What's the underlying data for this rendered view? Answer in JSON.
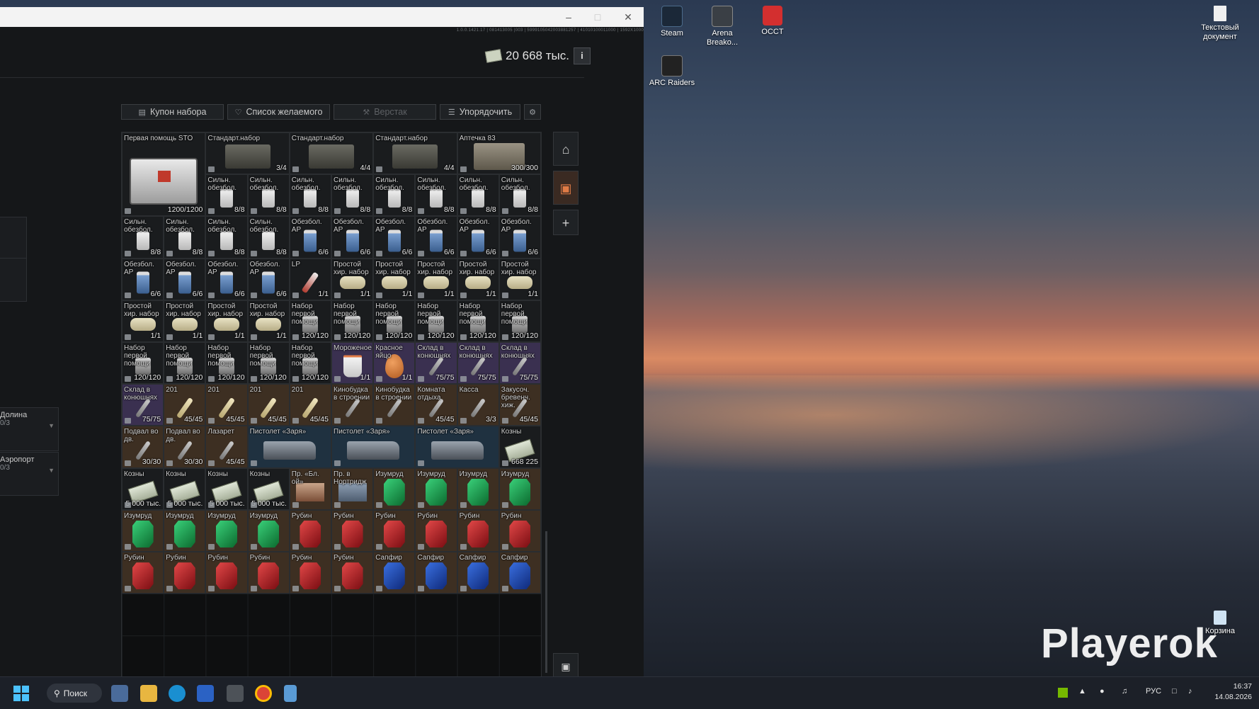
{
  "desktop": {
    "icons": [
      {
        "label": "Steam",
        "color": "#1b2838"
      },
      {
        "label": "Arena Breako...",
        "color": "#3a3f45"
      },
      {
        "label": "OCCT",
        "color": "#d32f2f"
      },
      {
        "label": "ARC Raiders",
        "color": "#222"
      },
      {
        "label": "Текстовый документ",
        "color": "#f0f0f0"
      },
      {
        "label": "Корзина",
        "color": "#cfe3f3"
      }
    ],
    "watermark": "Playerok"
  },
  "window": {
    "version": "1.0.0.1421.17 | 081413005 |003 | 5999105042003881257 | 41010100011000 | 1592X1000",
    "money": "20 668 тыс.",
    "info_label": "i",
    "toolbar": [
      {
        "label": "Купон набора",
        "icon": "gift-icon",
        "disabled": false
      },
      {
        "label": "Список желаемого",
        "icon": "heart-icon",
        "disabled": false
      },
      {
        "label": "Верстак",
        "icon": "wrench-icon",
        "disabled": true
      },
      {
        "label": "Упорядочить",
        "icon": "sort-icon",
        "disabled": false
      }
    ],
    "left_panels": [
      {
        "title": "Долина",
        "sub": "0/3"
      },
      {
        "title": "Аэропорт",
        "sub": "0/3"
      }
    ],
    "items": [
      {
        "name": "Первая помощь STO",
        "count": "1200/1200",
        "kind": "firstaid",
        "c": 0,
        "r": 0,
        "w": 2,
        "h": 2
      },
      {
        "name": "Стандарт.набор",
        "count": "3/4",
        "kind": "case",
        "c": 2,
        "r": 0,
        "w": 2,
        "h": 1
      },
      {
        "name": "Стандарт.набор",
        "count": "4/4",
        "kind": "case",
        "c": 4,
        "r": 0,
        "w": 2,
        "h": 1
      },
      {
        "name": "Стандарт.набор",
        "count": "4/4",
        "kind": "case",
        "c": 6,
        "r": 0,
        "w": 2,
        "h": 1
      },
      {
        "name": "Аптечка 83",
        "count": "300/300",
        "kind": "case2",
        "c": 8,
        "r": 0,
        "w": 2,
        "h": 1
      },
      {
        "name": "Сильн. обезбол.",
        "count": "8/8",
        "kind": "jar",
        "c": 2,
        "r": 1
      },
      {
        "name": "Сильн. обезбол.",
        "count": "8/8",
        "kind": "jar",
        "c": 3,
        "r": 1
      },
      {
        "name": "Сильн. обезбол.",
        "count": "8/8",
        "kind": "jar",
        "c": 4,
        "r": 1
      },
      {
        "name": "Сильн. обезбол.",
        "count": "8/8",
        "kind": "jar",
        "c": 5,
        "r": 1
      },
      {
        "name": "Сильн. обезбол.",
        "count": "8/8",
        "kind": "jar",
        "c": 6,
        "r": 1
      },
      {
        "name": "Сильн. обезбол.",
        "count": "8/8",
        "kind": "jar",
        "c": 7,
        "r": 1
      },
      {
        "name": "Сильн. обезбол.",
        "count": "8/8",
        "kind": "jar",
        "c": 8,
        "r": 1
      },
      {
        "name": "Сильн. обезбол.",
        "count": "8/8",
        "kind": "jar",
        "c": 9,
        "r": 1
      },
      {
        "name": "Сильн. обезбол.",
        "count": "8/8",
        "kind": "jar",
        "c": 0,
        "r": 2
      },
      {
        "name": "Сильн. обезбол.",
        "count": "8/8",
        "kind": "jar",
        "c": 1,
        "r": 2
      },
      {
        "name": "Сильн. обезбол.",
        "count": "8/8",
        "kind": "jar",
        "c": 2,
        "r": 2
      },
      {
        "name": "Сильн. обезбол.",
        "count": "8/8",
        "kind": "jar",
        "c": 3,
        "r": 2
      },
      {
        "name": "Обезбол. АР",
        "count": "6/6",
        "kind": "jarb",
        "c": 4,
        "r": 2
      },
      {
        "name": "Обезбол. АР",
        "count": "6/6",
        "kind": "jarb",
        "c": 5,
        "r": 2
      },
      {
        "name": "Обезбол. АР",
        "count": "6/6",
        "kind": "jarb",
        "c": 6,
        "r": 2
      },
      {
        "name": "Обезбол. АР",
        "count": "6/6",
        "kind": "jarb",
        "c": 7,
        "r": 2
      },
      {
        "name": "Обезбол. АР",
        "count": "6/6",
        "kind": "jarb",
        "c": 8,
        "r": 2
      },
      {
        "name": "Обезбол. АР",
        "count": "6/6",
        "kind": "jarb",
        "c": 9,
        "r": 2
      },
      {
        "name": "Обезбол. АР",
        "count": "6/6",
        "kind": "jarb",
        "c": 0,
        "r": 3
      },
      {
        "name": "Обезбол. АР",
        "count": "6/6",
        "kind": "jarb",
        "c": 1,
        "r": 3
      },
      {
        "name": "Обезбол. АР",
        "count": "6/6",
        "kind": "jarb",
        "c": 2,
        "r": 3
      },
      {
        "name": "Обезбол. АР",
        "count": "6/6",
        "kind": "jarb",
        "c": 3,
        "r": 3
      },
      {
        "name": "LP",
        "count": "1/1",
        "kind": "tube",
        "c": 4,
        "r": 3
      },
      {
        "name": "Простой хир. набор",
        "count": "1/1",
        "kind": "pouch",
        "c": 5,
        "r": 3
      },
      {
        "name": "Простой хир. набор",
        "count": "1/1",
        "kind": "pouch",
        "c": 6,
        "r": 3
      },
      {
        "name": "Простой хир. набор",
        "count": "1/1",
        "kind": "pouch",
        "c": 7,
        "r": 3
      },
      {
        "name": "Простой хир. набор",
        "count": "1/1",
        "kind": "pouch",
        "c": 8,
        "r": 3
      },
      {
        "name": "Простой хир. набор",
        "count": "1/1",
        "kind": "pouch",
        "c": 9,
        "r": 3
      },
      {
        "name": "Простой хир. набор",
        "count": "1/1",
        "kind": "pouch",
        "c": 0,
        "r": 4
      },
      {
        "name": "Простой хир. набор",
        "count": "1/1",
        "kind": "pouch",
        "c": 1,
        "r": 4
      },
      {
        "name": "Простой хир. набор",
        "count": "1/1",
        "kind": "pouch",
        "c": 2,
        "r": 4
      },
      {
        "name": "Простой хир. набор",
        "count": "1/1",
        "kind": "pouch",
        "c": 3,
        "r": 4
      },
      {
        "name": "Набор первой помощи",
        "count": "120/120",
        "kind": "kit",
        "c": 4,
        "r": 4
      },
      {
        "name": "Набор первой помощи",
        "count": "120/120",
        "kind": "kit",
        "c": 5,
        "r": 4
      },
      {
        "name": "Набор первой помощи",
        "count": "120/120",
        "kind": "kit",
        "c": 6,
        "r": 4
      },
      {
        "name": "Набор первой помощи",
        "count": "120/120",
        "kind": "kit",
        "c": 7,
        "r": 4
      },
      {
        "name": "Набор первой помощи",
        "count": "120/120",
        "kind": "kit",
        "c": 8,
        "r": 4
      },
      {
        "name": "Набор первой помощи",
        "count": "120/120",
        "kind": "kit",
        "c": 9,
        "r": 4
      },
      {
        "name": "Набор первой помощи",
        "count": "120/120",
        "kind": "kit",
        "c": 0,
        "r": 5
      },
      {
        "name": "Набор первой помощи",
        "count": "120/120",
        "kind": "kit",
        "c": 1,
        "r": 5
      },
      {
        "name": "Набор первой помощи",
        "count": "120/120",
        "kind": "kit",
        "c": 2,
        "r": 5
      },
      {
        "name": "Набор первой помощи",
        "count": "120/120",
        "kind": "kit",
        "c": 3,
        "r": 5
      },
      {
        "name": "Набор первой помощи",
        "count": "120/120",
        "kind": "kit",
        "c": 4,
        "r": 5
      },
      {
        "name": "Мороженое",
        "count": "1/1",
        "kind": "cup",
        "c": 5,
        "r": 5,
        "bg": "purple"
      },
      {
        "name": "Красное яйцо",
        "count": "1/1",
        "kind": "egg",
        "c": 6,
        "r": 5,
        "bg": "purple"
      },
      {
        "name": "Склад в конюшнях",
        "count": "75/75",
        "kind": "key",
        "c": 7,
        "r": 5,
        "bg": "purple"
      },
      {
        "name": "Склад в конюшнях",
        "count": "75/75",
        "kind": "key",
        "c": 8,
        "r": 5,
        "bg": "purple"
      },
      {
        "name": "Склад в конюшнях",
        "count": "75/75",
        "kind": "key",
        "c": 9,
        "r": 5,
        "bg": "purple"
      },
      {
        "name": "Склад в конюшнях",
        "count": "75/75",
        "kind": "key",
        "c": 0,
        "r": 6,
        "bg": "purple"
      },
      {
        "name": "201",
        "count": "45/45",
        "kind": "keyg",
        "c": 1,
        "r": 6,
        "bg": "brown"
      },
      {
        "name": "201",
        "count": "45/45",
        "kind": "keyg",
        "c": 2,
        "r": 6,
        "bg": "brown"
      },
      {
        "name": "201",
        "count": "45/45",
        "kind": "keyg",
        "c": 3,
        "r": 6,
        "bg": "brown"
      },
      {
        "name": "201",
        "count": "45/45",
        "kind": "keyg",
        "c": 4,
        "r": 6,
        "bg": "brown"
      },
      {
        "name": "Кинобудка в строении",
        "count": "",
        "kind": "key",
        "c": 5,
        "r": 6,
        "bg": "brown"
      },
      {
        "name": "Кинобудка в строении",
        "count": "",
        "kind": "key",
        "c": 6,
        "r": 6,
        "bg": "brown"
      },
      {
        "name": "Комната отдыха",
        "count": "45/45",
        "kind": "key",
        "c": 7,
        "r": 6,
        "bg": "brown"
      },
      {
        "name": "Касса",
        "count": "3/3",
        "kind": "key",
        "c": 8,
        "r": 6,
        "bg": "brown"
      },
      {
        "name": "Закусоч. бревенч. хиж.",
        "count": "45/45",
        "kind": "key",
        "c": 9,
        "r": 6,
        "bg": "brown"
      },
      {
        "name": "Подвал во дв.",
        "count": "30/30",
        "kind": "key",
        "c": 0,
        "r": 7,
        "bg": "brown"
      },
      {
        "name": "Подвал во дв.",
        "count": "30/30",
        "kind": "key",
        "c": 1,
        "r": 7,
        "bg": "brown"
      },
      {
        "name": "Лазарет",
        "count": "45/45",
        "kind": "key",
        "c": 2,
        "r": 7,
        "bg": "brown"
      },
      {
        "name": "Пистолет «Заря»",
        "count": "",
        "kind": "gun",
        "c": 3,
        "r": 7,
        "w": 2,
        "h": 1,
        "bg": "blue"
      },
      {
        "name": "Пистолет «Заря»",
        "count": "",
        "kind": "gun",
        "c": 5,
        "r": 7,
        "w": 2,
        "h": 1,
        "bg": "blue"
      },
      {
        "name": "Пистолет «Заря»",
        "count": "",
        "kind": "gun",
        "c": 7,
        "r": 7,
        "w": 2,
        "h": 1,
        "bg": "blue"
      },
      {
        "name": "Козны",
        "count": "668 225",
        "kind": "cash",
        "c": 9,
        "r": 7
      },
      {
        "name": "Козны",
        "count": "5 000 тыс.",
        "kind": "cash",
        "c": 0,
        "r": 8
      },
      {
        "name": "Козны",
        "count": "5 000 тыс.",
        "kind": "cash",
        "c": 1,
        "r": 8
      },
      {
        "name": "Козны",
        "count": "5 000 тыс.",
        "kind": "cash",
        "c": 2,
        "r": 8
      },
      {
        "name": "Козны",
        "count": "5 000 тыс.",
        "kind": "cash",
        "c": 3,
        "r": 8
      },
      {
        "name": "Пр. «Бл. ой»",
        "count": "",
        "kind": "doc",
        "c": 4,
        "r": 8,
        "bg": "brown"
      },
      {
        "name": "Пр. в Нортридж",
        "count": "",
        "kind": "doc2",
        "c": 5,
        "r": 8,
        "bg": "brown"
      },
      {
        "name": "Изумруд",
        "count": "",
        "kind": "emerald",
        "c": 6,
        "r": 8,
        "bg": "brown"
      },
      {
        "name": "Изумруд",
        "count": "",
        "kind": "emerald",
        "c": 7,
        "r": 8,
        "bg": "brown"
      },
      {
        "name": "Изумруд",
        "count": "",
        "kind": "emerald",
        "c": 8,
        "r": 8,
        "bg": "brown"
      },
      {
        "name": "Изумруд",
        "count": "",
        "kind": "emerald",
        "c": 9,
        "r": 8,
        "bg": "brown"
      },
      {
        "name": "Изумруд",
        "count": "",
        "kind": "emerald",
        "c": 0,
        "r": 9,
        "bg": "brown"
      },
      {
        "name": "Изумруд",
        "count": "",
        "kind": "emerald",
        "c": 1,
        "r": 9,
        "bg": "brown"
      },
      {
        "name": "Изумруд",
        "count": "",
        "kind": "emerald",
        "c": 2,
        "r": 9,
        "bg": "brown"
      },
      {
        "name": "Изумруд",
        "count": "",
        "kind": "emerald",
        "c": 3,
        "r": 9,
        "bg": "brown"
      },
      {
        "name": "Рубин",
        "count": "",
        "kind": "ruby",
        "c": 4,
        "r": 9,
        "bg": "brown"
      },
      {
        "name": "Рубин",
        "count": "",
        "kind": "ruby",
        "c": 5,
        "r": 9,
        "bg": "brown"
      },
      {
        "name": "Рубин",
        "count": "",
        "kind": "ruby",
        "c": 6,
        "r": 9,
        "bg": "brown"
      },
      {
        "name": "Рубин",
        "count": "",
        "kind": "ruby",
        "c": 7,
        "r": 9,
        "bg": "brown"
      },
      {
        "name": "Рубин",
        "count": "",
        "kind": "ruby",
        "c": 8,
        "r": 9,
        "bg": "brown"
      },
      {
        "name": "Рубин",
        "count": "",
        "kind": "ruby",
        "c": 9,
        "r": 9,
        "bg": "brown"
      },
      {
        "name": "Рубин",
        "count": "",
        "kind": "ruby",
        "c": 0,
        "r": 10,
        "bg": "brown"
      },
      {
        "name": "Рубин",
        "count": "",
        "kind": "ruby",
        "c": 1,
        "r": 10,
        "bg": "brown"
      },
      {
        "name": "Рубин",
        "count": "",
        "kind": "ruby",
        "c": 2,
        "r": 10,
        "bg": "brown"
      },
      {
        "name": "Рубин",
        "count": "",
        "kind": "ruby",
        "c": 3,
        "r": 10,
        "bg": "brown"
      },
      {
        "name": "Рубин",
        "count": "",
        "kind": "ruby",
        "c": 4,
        "r": 10,
        "bg": "brown"
      },
      {
        "name": "Рубин",
        "count": "",
        "kind": "ruby",
        "c": 5,
        "r": 10,
        "bg": "brown"
      },
      {
        "name": "Сапфир",
        "count": "",
        "kind": "sapphire",
        "c": 6,
        "r": 10,
        "bg": "brown"
      },
      {
        "name": "Сапфир",
        "count": "",
        "kind": "sapphire",
        "c": 7,
        "r": 10,
        "bg": "brown"
      },
      {
        "name": "Сапфир",
        "count": "",
        "kind": "sapphire",
        "c": 8,
        "r": 10,
        "bg": "brown"
      },
      {
        "name": "Сапфир",
        "count": "",
        "kind": "sapphire",
        "c": 9,
        "r": 10,
        "bg": "brown"
      }
    ]
  },
  "taskbar": {
    "search": "Поиск",
    "lang": "РУС",
    "time": "16:37",
    "date": "14.08.2026"
  }
}
